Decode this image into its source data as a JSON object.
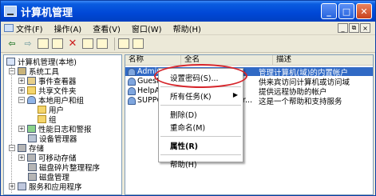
{
  "window": {
    "title": "计算机管理"
  },
  "menubar": {
    "items": [
      "文件(F)",
      "操作(A)",
      "查看(V)",
      "窗口(W)",
      "帮助(H)"
    ],
    "mdi_buttons": [
      "_",
      "⧉",
      "×"
    ]
  },
  "tree": {
    "root": "计算机管理(本地)",
    "items": [
      {
        "label": "系统工具",
        "expander": "−"
      },
      {
        "label": "事件查看器",
        "expander": "+"
      },
      {
        "label": "共享文件夹",
        "expander": "+"
      },
      {
        "label": "本地用户和组",
        "expander": "−"
      },
      {
        "label": "用户",
        "expander": ""
      },
      {
        "label": "组",
        "expander": ""
      },
      {
        "label": "性能日志和警报",
        "expander": "+"
      },
      {
        "label": "设备管理器",
        "expander": ""
      },
      {
        "label": "存储",
        "expander": "−"
      },
      {
        "label": "可移动存储",
        "expander": "+"
      },
      {
        "label": "磁盘碎片整理程序",
        "expander": ""
      },
      {
        "label": "磁盘管理",
        "expander": ""
      },
      {
        "label": "服务和应用程序",
        "expander": "+"
      }
    ]
  },
  "list": {
    "columns": [
      "名称",
      "全名",
      "描述"
    ],
    "rows": [
      {
        "name": "Admin",
        "fullname": "",
        "desc": "管理计算机(域)的内置帐户",
        "selected": true
      },
      {
        "name": "Guest",
        "fullname": "",
        "desc": "供来宾访问计算机或访问域",
        "selected": false
      },
      {
        "name": "HelpA",
        "fullname": "",
        "desc": "提供远程协助的帐户",
        "selected": false
      },
      {
        "name": "SUPPO",
        "fullname": "or...",
        "desc": "这是一个帮助和支持服务",
        "selected": false
      }
    ]
  },
  "context_menu": {
    "items": [
      {
        "label": "设置密码(S)...",
        "bold": false,
        "submenu": false
      },
      {
        "label": "所有任务(K)",
        "bold": false,
        "submenu": true
      },
      {
        "label": "删除(D)",
        "bold": false,
        "submenu": false
      },
      {
        "label": "重命名(M)",
        "bold": false,
        "submenu": false
      },
      {
        "label": "属性(R)",
        "bold": true,
        "submenu": false
      },
      {
        "label": "帮助(H)",
        "bold": false,
        "submenu": false
      }
    ],
    "submenu_arrow": "▶"
  },
  "colors": {
    "titlebar": "#0047d6",
    "selection": "#316ac5",
    "highlight_ellipse": "#d6252b"
  }
}
